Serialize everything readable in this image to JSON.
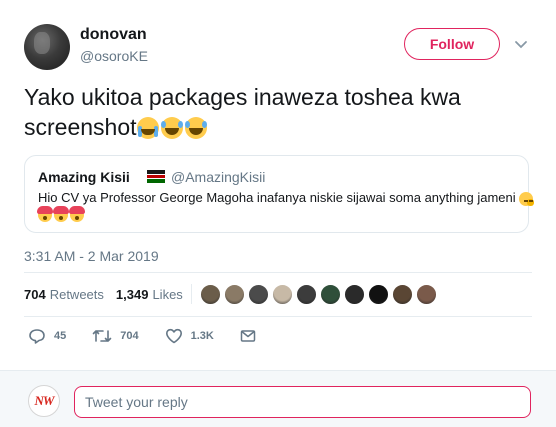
{
  "tweet": {
    "author": {
      "name": "donovan",
      "handle": "@osoroKE"
    },
    "follow_label": "Follow",
    "text": "Yako ukitoa packages inaweza toshea kwa screenshot",
    "text_emojis": [
      "loudly-crying-face",
      "face-with-tears-of-joy",
      "face-with-tears-of-joy"
    ],
    "quoted": {
      "name": "Amazing Kisii",
      "flag": "kenya-flag",
      "handle": "@AmazingKisii",
      "text": "Hio CV ya Professor George Magoha inafanya niskie sijawai soma anything jameni",
      "text_emoji": "face-with-hand-over-mouth",
      "emojis": [
        "exploding-head",
        "exploding-head",
        "exploding-head"
      ]
    },
    "timestamp": "3:31 AM - 2 Mar 2019",
    "stats": {
      "retweets_count": "704",
      "retweets_label": "Retweets",
      "likes_count": "1,349",
      "likes_label": "Likes",
      "liker_colors": [
        "#6b5d4a",
        "#8a7a66",
        "#4b4b4b",
        "#c7b9a6",
        "#3c3c3c",
        "#2f4f3a",
        "#2a2a2a",
        "#111111",
        "#5a4634",
        "#7a5a4a"
      ]
    },
    "actions": {
      "replies": "45",
      "retweets": "704",
      "likes": "1.3K"
    }
  },
  "reply": {
    "avatar_text": "NW",
    "placeholder": "Tweet your reply"
  },
  "colors": {
    "accent": "#e0245e",
    "muted": "#657786",
    "text": "#14171a"
  }
}
